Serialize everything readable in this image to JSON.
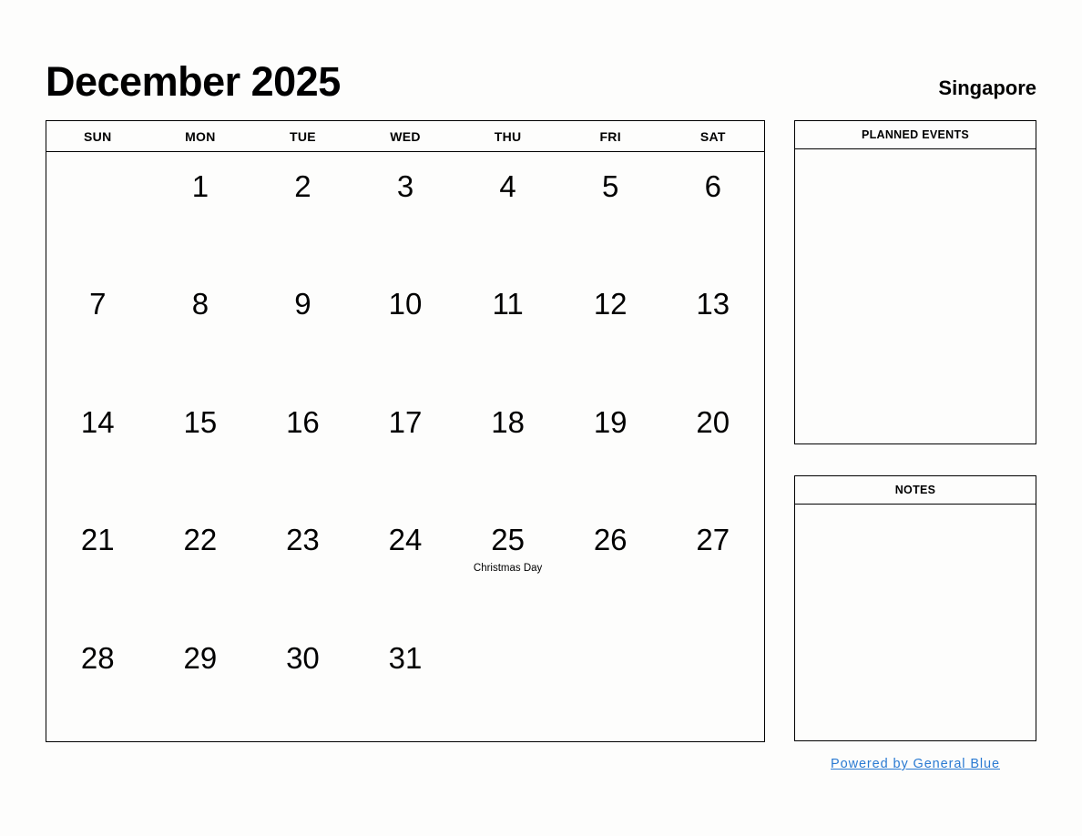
{
  "header": {
    "month_title": "December 2025",
    "location": "Singapore"
  },
  "calendar": {
    "weekdays": [
      "SUN",
      "MON",
      "TUE",
      "WED",
      "THU",
      "FRI",
      "SAT"
    ],
    "weeks": [
      [
        {
          "day": ""
        },
        {
          "day": "1"
        },
        {
          "day": "2"
        },
        {
          "day": "3"
        },
        {
          "day": "4"
        },
        {
          "day": "5"
        },
        {
          "day": "6"
        }
      ],
      [
        {
          "day": "7"
        },
        {
          "day": "8"
        },
        {
          "day": "9"
        },
        {
          "day": "10"
        },
        {
          "day": "11"
        },
        {
          "day": "12"
        },
        {
          "day": "13"
        }
      ],
      [
        {
          "day": "14"
        },
        {
          "day": "15"
        },
        {
          "day": "16"
        },
        {
          "day": "17"
        },
        {
          "day": "18"
        },
        {
          "day": "19"
        },
        {
          "day": "20"
        }
      ],
      [
        {
          "day": "21"
        },
        {
          "day": "22"
        },
        {
          "day": "23"
        },
        {
          "day": "24"
        },
        {
          "day": "25",
          "event": "Christmas Day"
        },
        {
          "day": "26"
        },
        {
          "day": "27"
        }
      ],
      [
        {
          "day": "28"
        },
        {
          "day": "29"
        },
        {
          "day": "30"
        },
        {
          "day": "31"
        },
        {
          "day": ""
        },
        {
          "day": ""
        },
        {
          "day": ""
        }
      ]
    ]
  },
  "panels": [
    {
      "title": "PLANNED EVENTS",
      "content": ""
    },
    {
      "title": "NOTES",
      "content": ""
    }
  ],
  "footer": {
    "link_text": "Powered by General Blue",
    "link_color": "#2a7ad2"
  }
}
